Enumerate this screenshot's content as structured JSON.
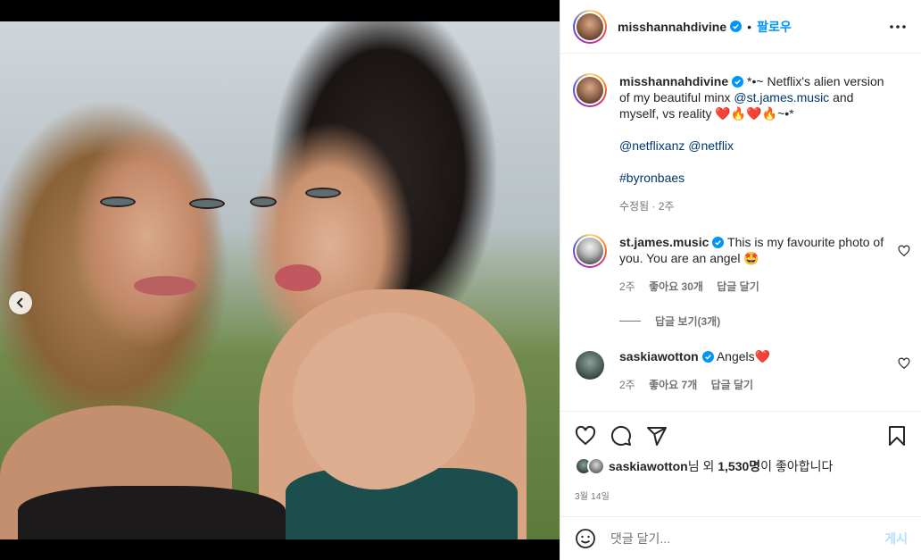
{
  "post": {
    "username": "misshannahdivine",
    "follow_label": "팔로우",
    "separator": "•",
    "media": {
      "current_slide": 2,
      "total_slides": 2
    }
  },
  "caption": {
    "username": "misshannahdivine",
    "text_1": "*•~ Netflix's alien version of my beautiful minx ",
    "mention_1": "@st.james.music",
    "text_2": " and myself, vs reality ❤️🔥❤️🔥~•*",
    "mention_2": "@netflixanz",
    "mention_3": "@netflix",
    "hashtag": "#byronbaes",
    "meta": "수정됨 · 2주"
  },
  "comments": [
    {
      "username": "st.james.music",
      "text": "This is my favourite photo of you. You are an angel 🤩",
      "age": "2주",
      "likes": "좋아요 30개",
      "reply": "답글 달기",
      "view_replies": "답글 보기(3개)"
    },
    {
      "username": "saskiawotton",
      "text": "Angels❤️",
      "age": "2주",
      "likes": "좋아요 7개",
      "reply": "답글 달기"
    }
  ],
  "likes_summary": {
    "liker": "saskiawotton",
    "middle": "님 외 ",
    "count": "1,530명",
    "suffix": "이 좋아합니다"
  },
  "date": "3월 14일",
  "composer": {
    "placeholder": "댓글 달기...",
    "post_label": "게시"
  },
  "colors": {
    "accent": "#0095f6",
    "link": "#00376b",
    "muted": "#737373",
    "heart": "#ed4956"
  }
}
